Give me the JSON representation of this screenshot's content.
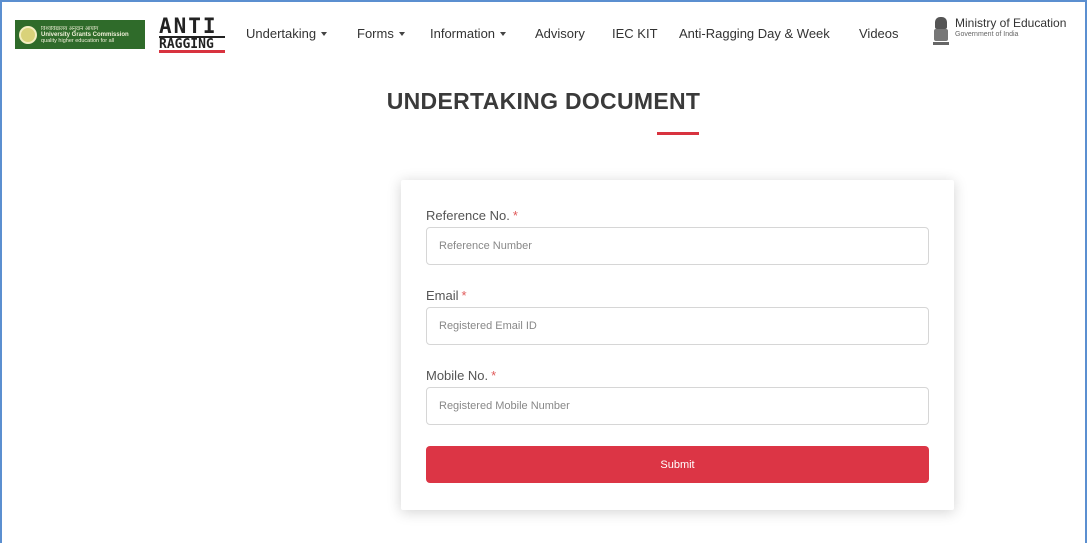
{
  "header": {
    "ugc_logo": {
      "line1": "विश्वविद्यालय अनुदान आयोग",
      "line2": "University Grants Commission",
      "line3": "quality higher education for all"
    },
    "anti_ragging_logo": {
      "top": "ANTI",
      "bottom": "RAGGING"
    },
    "nav": [
      {
        "label": "Undertaking",
        "dropdown": true
      },
      {
        "label": "Forms",
        "dropdown": true
      },
      {
        "label": "Information",
        "dropdown": true
      },
      {
        "label": "Advisory",
        "dropdown": false
      },
      {
        "label": "IEC KIT",
        "dropdown": false
      },
      {
        "label": "Anti-Ragging Day & Week",
        "dropdown": false
      },
      {
        "label": "Videos",
        "dropdown": false
      }
    ],
    "ministry": {
      "title": "Ministry of Education",
      "subtitle": "Government of India"
    }
  },
  "page": {
    "title": "UNDERTAKING DOCUMENT"
  },
  "form": {
    "required_marker": "*",
    "reference": {
      "label": "Reference No.",
      "placeholder": "Reference Number",
      "value": ""
    },
    "email": {
      "label": "Email",
      "placeholder": "Registered Email ID",
      "value": ""
    },
    "mobile": {
      "label": "Mobile No.",
      "placeholder": "Registered Mobile Number",
      "value": ""
    },
    "submit_label": "Submit"
  },
  "colors": {
    "accent": "#dc3545",
    "ugc_green": "#2f6b2a",
    "frame_border": "#5b8fd0"
  }
}
